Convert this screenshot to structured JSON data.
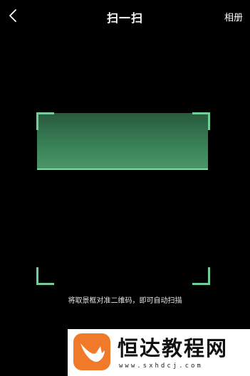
{
  "header": {
    "title": "扫一扫",
    "album_label": "相册",
    "back_icon": "chevron-left-icon"
  },
  "scanner": {
    "hint": "将取景框对准二维码，即可自动扫描",
    "accent_color": "#6fcf97"
  },
  "watermark": {
    "brand": "恒达教程网",
    "url": "www.sxhdcj.com"
  }
}
